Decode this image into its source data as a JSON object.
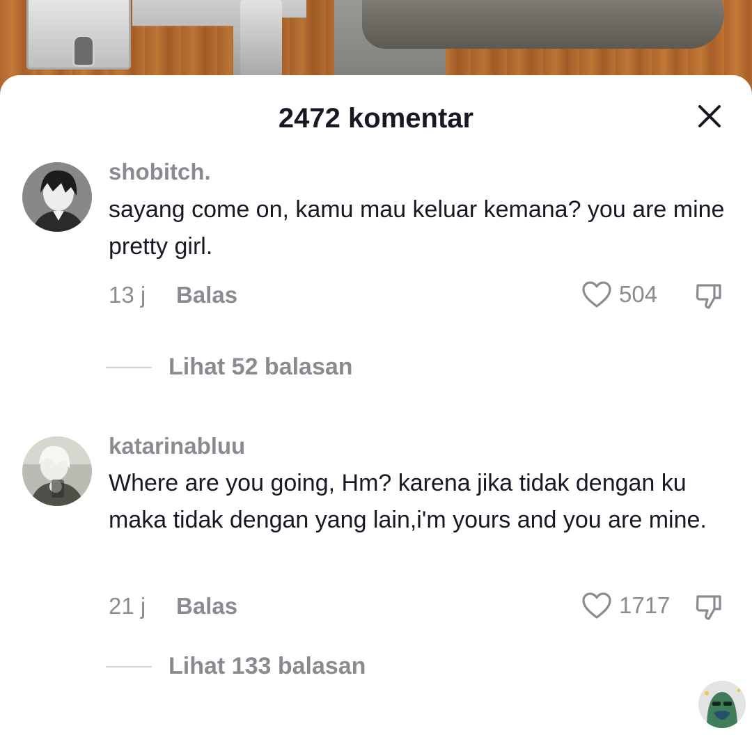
{
  "header": {
    "title": "2472 komentar"
  },
  "comments": [
    {
      "username": "shobitch.",
      "text": "sayang come on, kamu mau keluar kemana? you are mine pretty girl.",
      "time": "13 j",
      "reply_label": "Balas",
      "likes": "504",
      "view_replies": "Lihat 52 balasan"
    },
    {
      "username": "katarinabluu",
      "text": "Where are you going, Hm? karena jika tidak dengan ku maka tidak dengan yang lain,i'm yours and you are mine.",
      "time": "21 j",
      "reply_label": "Balas",
      "likes": "1717",
      "view_replies": "Lihat 133 balasan"
    }
  ],
  "icons": {
    "close": "close-icon",
    "like": "heart-icon",
    "dislike": "thumbs-down-icon"
  },
  "colors": {
    "primary_text": "#161823",
    "secondary_text": "#8a8b91",
    "divider": "#d0d1d4"
  }
}
